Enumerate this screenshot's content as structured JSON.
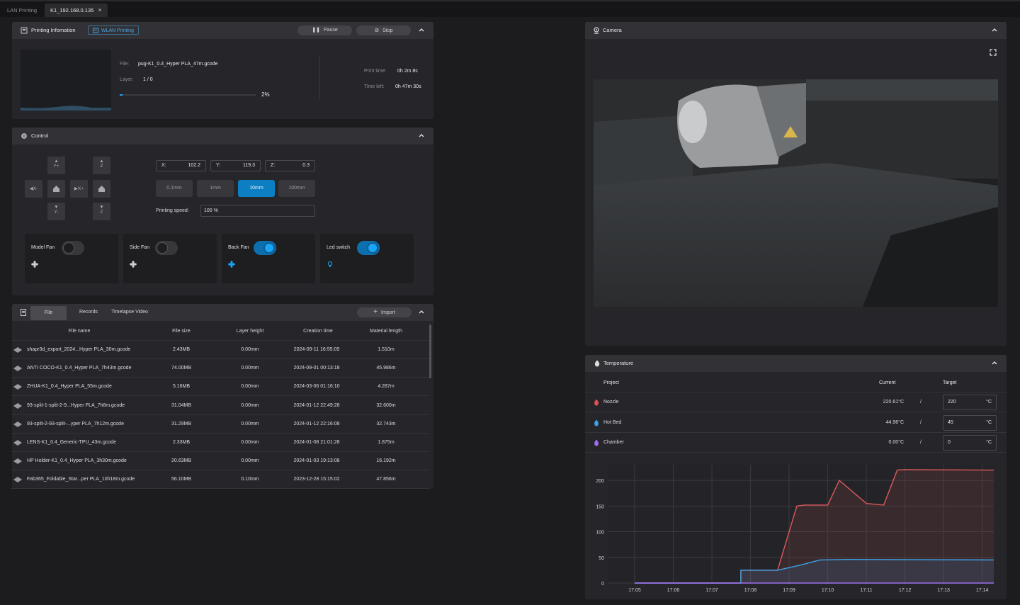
{
  "tabs": [
    {
      "label": "LAN Printing",
      "active": false
    },
    {
      "label": "K1_192.168.0.135",
      "active": true
    }
  ],
  "printing": {
    "title": "Printing Infomation",
    "wlan_label": "WLAN Printing",
    "pause_label": "Pause",
    "stop_label": "Stop",
    "file_label": "File:",
    "file_value": "pug-K1_0.4_Hyper PLA_47m.gcode",
    "layer_label": "Layer:",
    "layer_value": "1 / 0",
    "progress_text": "2%",
    "progress_value": 0.02,
    "print_time_label": "Print time:",
    "print_time_value": "0h 2m 8s",
    "time_left_label": "Time left:",
    "time_left_value": "0h 47m 30s"
  },
  "control": {
    "title": "Control",
    "jog": {
      "y_plus": "Y+",
      "y_minus": "Y-",
      "x_minus": "X-",
      "x_plus": "X+",
      "z_up": "Z",
      "z_down": "Z"
    },
    "x_label": "X:",
    "x_value": "102.2",
    "y_label": "Y:",
    "y_value": "119.3",
    "z_label": "Z:",
    "z_value": "0.3",
    "steps": [
      "0.1mm",
      "1mm",
      "10mm",
      "100mm"
    ],
    "selected_step": "10mm",
    "speed_label": "Printing speed:",
    "speed_value": "100 %",
    "fans": [
      {
        "name": "Model Fan",
        "on": false,
        "icon": "fan-icon"
      },
      {
        "name": "Side Fan",
        "on": false,
        "icon": "fan-icon"
      },
      {
        "name": "Back Fan",
        "on": true,
        "icon": "fan-icon"
      },
      {
        "name": "Led switch",
        "on": true,
        "icon": "bulb-icon"
      }
    ]
  },
  "files": {
    "tabs": [
      "File",
      "Records",
      "Timelapse Video"
    ],
    "import_label": "Import",
    "columns": [
      "File name",
      "File size",
      "Layer height",
      "Creation time",
      "Material length"
    ],
    "rows": [
      {
        "name": "shapr3d_export_2024...Hyper PLA_30m.gcode",
        "size": "2.43MB",
        "layer": "0.00mm",
        "created": "2024-09-11 16:55:09",
        "length": "1.510m"
      },
      {
        "name": "ANTI COCO-K1_0.4_Hyper PLA_7h43m.gcode",
        "size": "74.00MB",
        "layer": "0.00mm",
        "created": "2024-09-01 00:13:18",
        "length": "45.986m"
      },
      {
        "name": "ZHUA-K1_0.4_Hyper PLA_55m.gcode",
        "size": "5.16MB",
        "layer": "0.00mm",
        "created": "2024-03-06 01:16:10",
        "length": "4.287m"
      },
      {
        "name": "93-split-1-split-2-9...Hyper PLA_7h8m.gcode",
        "size": "31.04MB",
        "layer": "0.00mm",
        "created": "2024-01-12 22:49:28",
        "length": "32.600m"
      },
      {
        "name": "93-split-2-93-split-...yper PLA_7h12m.gcode",
        "size": "31.29MB",
        "layer": "0.00mm",
        "created": "2024-01-12 22:16:08",
        "length": "32.743m"
      },
      {
        "name": "LENS-K1_0.4_Generic-TPU_43m.gcode",
        "size": "2.33MB",
        "layer": "0.00mm",
        "created": "2024-01-08 21:01:28",
        "length": "1.875m"
      },
      {
        "name": "HP Holder-K1_0.4_Hyper PLA_3h30m.gcode",
        "size": "20.63MB",
        "layer": "0.00mm",
        "created": "2024-01-03 19:13:08",
        "length": "16.192m"
      },
      {
        "name": "Fab365_Foldable_Star...per PLA_10h18m.gcode",
        "size": "56.10MB",
        "layer": "0.10mm",
        "created": "2023-12-28 15:15:02",
        "length": "47.856m"
      }
    ]
  },
  "camera": {
    "title": "Camera"
  },
  "temperature": {
    "title": "Temperature",
    "col_project": "Project",
    "col_current": "Current",
    "col_target": "Target",
    "unit": "°C",
    "separator": "/",
    "rows": [
      {
        "name": "Nozzle",
        "current": "220.61°C",
        "target": "220",
        "color": "#e2504f"
      },
      {
        "name": "Hot Bed",
        "current": "44.96°C",
        "target": "45",
        "color": "#3aa2e8"
      },
      {
        "name": "Chamber",
        "current": "0.00°C",
        "target": "0",
        "color": "#9d6ef0"
      }
    ]
  },
  "chart_data": {
    "type": "line",
    "title": "",
    "xlabel": "",
    "ylabel": "",
    "x_ticks": [
      "17:05",
      "17:06",
      "17:07",
      "17:08",
      "17:09",
      "17:10",
      "17:11",
      "17:12",
      "17:13",
      "17:14"
    ],
    "y_ticks": [
      0,
      50,
      100,
      150,
      200
    ],
    "ylim": [
      0,
      225
    ],
    "grid": true,
    "series": [
      {
        "color": "#d95a5a",
        "points": [
          [
            0,
            0
          ],
          [
            2.75,
            0
          ],
          [
            2.75,
            25
          ],
          [
            3.7,
            25
          ],
          [
            4.2,
            150
          ],
          [
            4.4,
            152
          ],
          [
            5.0,
            152
          ],
          [
            5.3,
            200
          ],
          [
            6.0,
            155
          ],
          [
            6.45,
            152
          ],
          [
            6.8,
            220
          ],
          [
            7.0,
            221
          ],
          [
            9.3,
            220
          ]
        ]
      },
      {
        "color": "#3ea1e6",
        "points": [
          [
            0,
            0
          ],
          [
            2.75,
            0
          ],
          [
            2.75,
            25
          ],
          [
            3.7,
            25
          ],
          [
            4.3,
            35
          ],
          [
            4.8,
            45
          ],
          [
            5.5,
            46
          ],
          [
            9.3,
            45
          ]
        ]
      },
      {
        "color": "#9d6ef0",
        "points": [
          [
            0,
            0
          ],
          [
            9.3,
            0
          ]
        ]
      }
    ]
  }
}
